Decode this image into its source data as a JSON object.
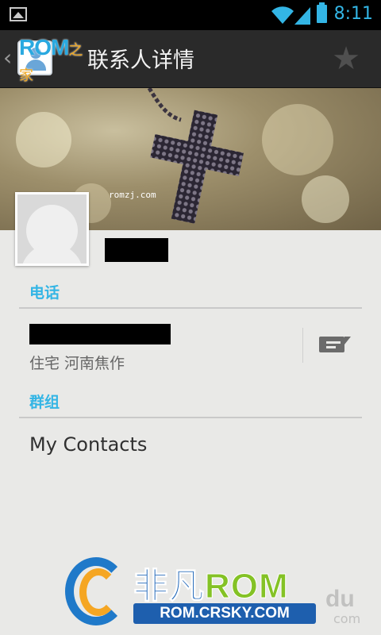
{
  "status_bar": {
    "time": "8:11",
    "icons": [
      "gallery-icon",
      "wifi-icon",
      "signal-icon",
      "battery-icon"
    ]
  },
  "action_bar": {
    "title": "联系人详情",
    "watermark_rom": "ROM",
    "watermark_zhijia": "之家",
    "star_icon": "star-outline-icon"
  },
  "header": {
    "photo_watermark": "romzj.com"
  },
  "phone_section": {
    "header": "电话",
    "type_location": "住宅 河南焦作",
    "message_icon": "message-icon"
  },
  "groups_section": {
    "header": "群组",
    "group": "My Contacts"
  },
  "bottom_watermark": {
    "brand_cn": "非凡",
    "brand_rom": "ROM",
    "url": "ROM.CRSKY.COM",
    "faint_text": "du",
    "faint_com": "com"
  },
  "colors": {
    "accent": "#33b5e5",
    "action_bar": "#2a2a2a",
    "background": "#e9e9e7"
  }
}
